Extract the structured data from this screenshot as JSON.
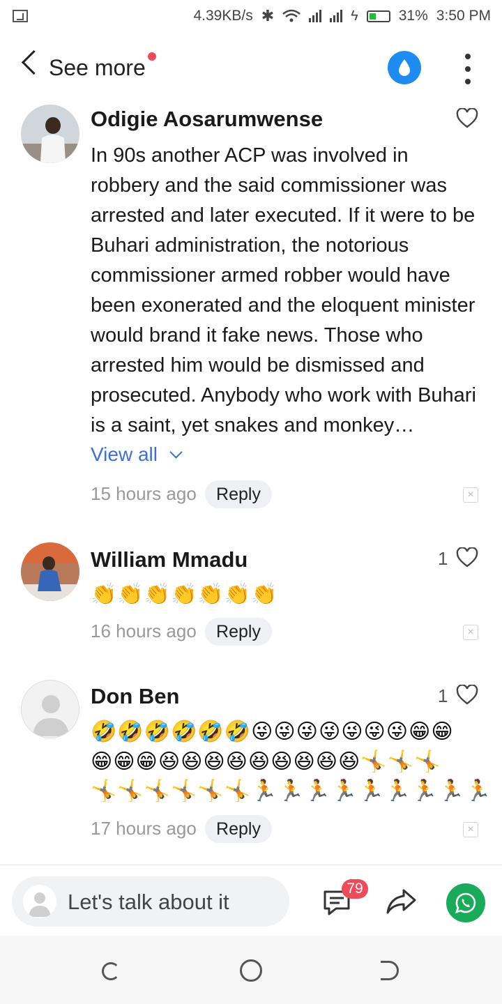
{
  "status_bar": {
    "net_speed": "4.39KB/s",
    "battery": "31%",
    "time": "3:50 PM"
  },
  "header": {
    "back_label": "See more"
  },
  "comments": [
    {
      "author": "Odigie Aosarumwense",
      "likes": "",
      "text": "In 90s another ACP was involved in robbery and the said commissioner was arrested and later executed. If it were to be Buhari administration, the notorious commissioner armed robber would have been exonerated and the eloquent minister would brand it fake news. Those who arrested him would be dismissed and prosecuted. Anybody who work with Buhari is a saint, yet snakes and monkey…",
      "view_all": "View all",
      "time": "15 hours ago",
      "reply": "Reply"
    },
    {
      "author": "William Mmadu",
      "likes": "1",
      "emoji": "👏👏👏👏👏👏👏",
      "time": "16 hours ago",
      "reply": "Reply"
    },
    {
      "author": "Don Ben",
      "likes": "1",
      "emoji_lines": [
        "🤣🤣🤣🤣🤣🤣😜😜😜😜😜😜😜😁😁",
        "😁😁😁😆😆😆😆😆😆😆😆😆🤸🤸🤸",
        "🤸🤸🤸🤸🤸🤸🏃🏃🏃🏃🏃🏃🏃🏃🏃"
      ],
      "time": "17 hours ago",
      "reply": "Reply"
    }
  ],
  "bottom_bar": {
    "input_placeholder": "Let's talk about it",
    "comment_count": "79"
  },
  "colors": {
    "accent_blue": "#1e8bf0",
    "link_blue": "#3d6fdc",
    "badge_red": "#ef4a5a",
    "whatsapp_green": "#1aab5a"
  }
}
